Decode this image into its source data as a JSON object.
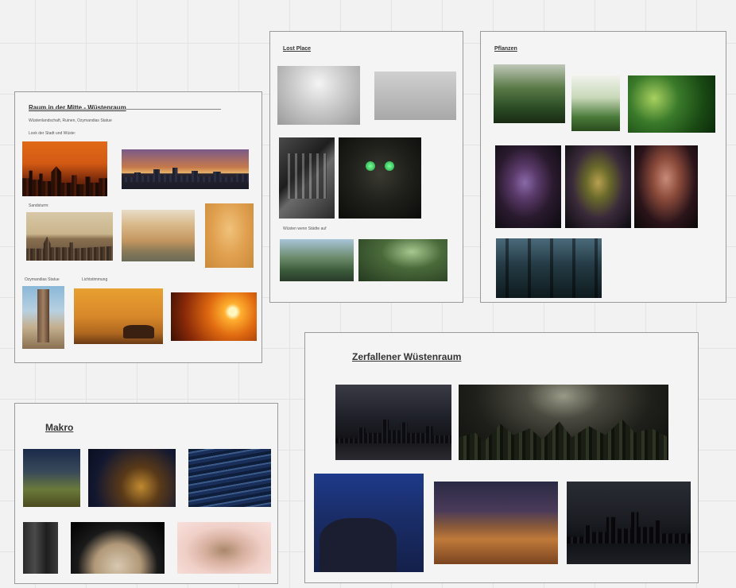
{
  "frames": {
    "raum": {
      "title": "Raum in der Mitte - Wüstenraum",
      "subtitle": "Wüstenlandschaft, Ruinen, Ozymandias Statue",
      "look": "Look der Stadt und Wüste:",
      "sandsturm": "Sandsturm:",
      "ozymandias": "Ozymandias Statue",
      "licht": "Lichtstimmung"
    },
    "lost_place": {
      "title": "Lost Place",
      "note": "Wüsten wenn Städte auf"
    },
    "pflanzen": {
      "title": "Pflanzen"
    },
    "makro": {
      "title": "Makro"
    },
    "zerfallen": {
      "title": "Zerfallener Wüstenraum"
    }
  },
  "colors": {
    "canvas": "#f2f2f2",
    "grid": "#e3e3e3",
    "frame_border": "#9a9a9a",
    "title_text": "#333333"
  }
}
